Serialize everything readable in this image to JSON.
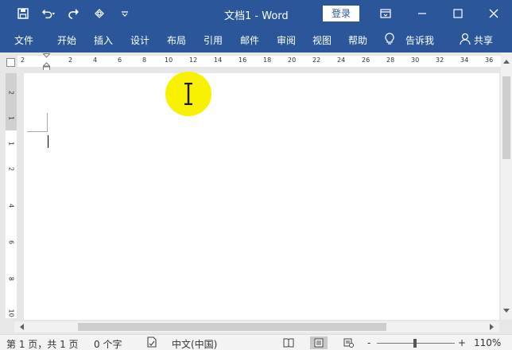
{
  "titlebar": {
    "title": "文档1  -  Word",
    "login_label": "登录",
    "qat_icons": [
      "save-icon",
      "undo-icon",
      "redo-icon",
      "touch-mode-icon",
      "customize-qat-icon"
    ],
    "window_controls": [
      "ribbon-display-options-icon",
      "minimize-icon",
      "maximize-icon",
      "close-icon"
    ]
  },
  "ribbon": {
    "tabs": [
      "文件",
      "开始",
      "插入",
      "设计",
      "布局",
      "引用",
      "邮件",
      "审阅",
      "视图",
      "帮助"
    ],
    "tell_me": "告诉我",
    "share": "共享"
  },
  "ruler": {
    "h_ticks": [
      "2",
      "2",
      "4",
      "6",
      "8",
      "10",
      "12",
      "14",
      "16",
      "18",
      "20",
      "22",
      "24",
      "26",
      "28",
      "30",
      "32",
      "34",
      "36"
    ],
    "v_ticks": [
      "2",
      "1",
      "1",
      "2",
      "4",
      "6",
      "8",
      "10"
    ]
  },
  "status": {
    "page": "第 1 页，共 1 页",
    "words": "0 个字",
    "language": "中文(中国)",
    "zoom_out": "-",
    "zoom_in": "+",
    "zoom": "110%"
  },
  "colors": {
    "brand": "#2b579a",
    "highlight": "#f8f200"
  }
}
